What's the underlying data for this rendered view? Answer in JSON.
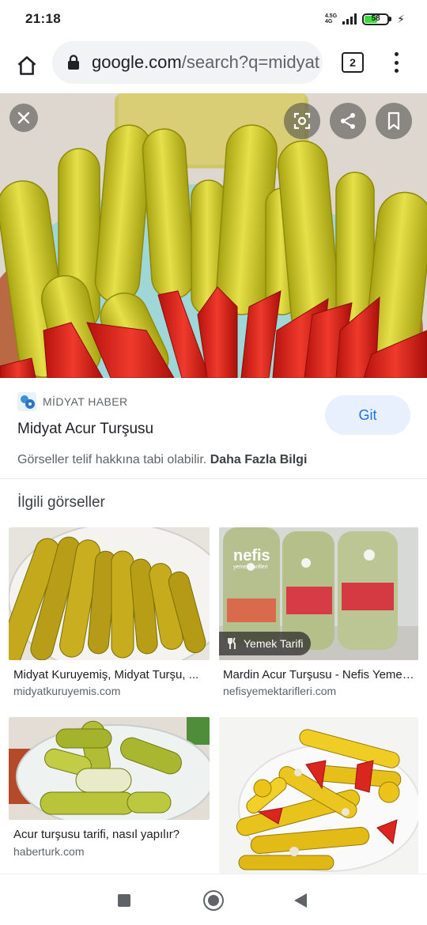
{
  "status_bar": {
    "time": "21:18",
    "network_type_top": "4.5G",
    "network_type_bottom": "4G",
    "battery_level": "58",
    "charging_icon": "bolt-icon"
  },
  "browser": {
    "url_host": "google.com",
    "url_path": "/search?q=midyat",
    "tab_count": "2",
    "icons": {
      "home": "home-icon",
      "lock": "lock-icon",
      "menu": "more-vert-icon"
    }
  },
  "hero": {
    "icons": {
      "close": "close-icon",
      "lens": "lens-icon",
      "share": "share-icon",
      "bookmark": "bookmark-icon"
    }
  },
  "source": {
    "name": "MİDYAT HABER",
    "title": "Midyat Acur Turşusu",
    "visit_label": "Git",
    "copyright_text": "Görseller telif hakkına tabi olabilir.",
    "learn_more": "Daha Fazla Bilgi"
  },
  "related": {
    "heading": "İlgili görseller",
    "items": [
      {
        "title": "Midyat Kuruyemiş, Midyat Turşu, ...",
        "domain": "midyatkuruyemis.com"
      },
      {
        "title": "Mardin Acur Turşusu - Nefis Yemek ...",
        "domain": "nefisyemektarifleri.com",
        "badge": "Yemek Tarifi",
        "overlay_brand": "nefis",
        "overlay_brand_sub": "yemek tarifleri"
      },
      {
        "title": "Acur turşusu tarifi, nasıl yapılır?",
        "domain": "haberturk.com"
      },
      {
        "title": "",
        "domain": ""
      }
    ]
  },
  "colors": {
    "accent": "#1a73e8",
    "accent_bg": "#e8f0fe",
    "text_primary": "#202124",
    "text_secondary": "#5f6368",
    "pickle_yellow": "#d4cc1e",
    "pepper_red": "#d8221b"
  }
}
